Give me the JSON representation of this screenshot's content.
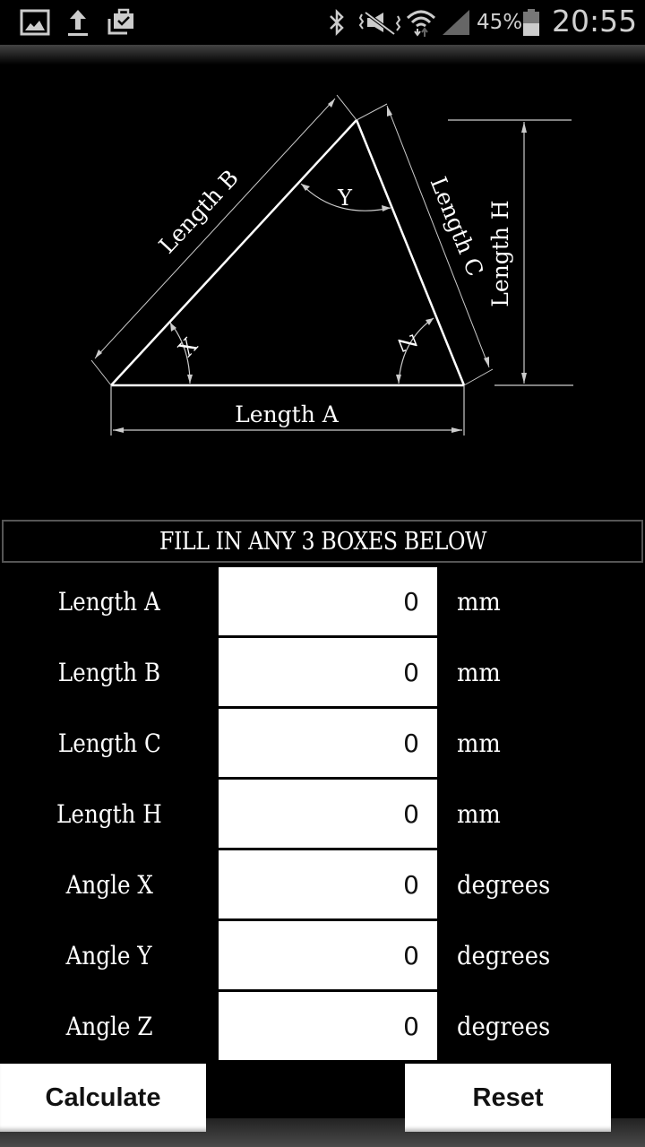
{
  "statusbar": {
    "left_icons": [
      "gallery-icon",
      "upload-icon",
      "shopping-bag-check-icon"
    ],
    "right_icons": [
      "bluetooth-icon",
      "vibrate-mute-icon",
      "wifi-icon",
      "signal-icon",
      "battery-icon"
    ],
    "battery_percent": "45%",
    "battery_level": 0.45,
    "time": "20:55"
  },
  "diagram": {
    "labels": {
      "length_a": "Length A",
      "length_b": "Length B",
      "length_c": "Length C",
      "length_h": "Length H",
      "angle_x": "X",
      "angle_y": "Y",
      "angle_z": "Z"
    }
  },
  "banner": "FILL IN ANY 3 BOXES BELOW",
  "fields": [
    {
      "label": "Length A",
      "value": "0",
      "unit": "mm"
    },
    {
      "label": "Length B",
      "value": "0",
      "unit": "mm"
    },
    {
      "label": "Length C",
      "value": "0",
      "unit": "mm"
    },
    {
      "label": "Length H",
      "value": "0",
      "unit": "mm"
    },
    {
      "label": "Angle X",
      "value": "0",
      "unit": "degrees"
    },
    {
      "label": "Angle Y",
      "value": "0",
      "unit": "degrees"
    },
    {
      "label": "Angle Z",
      "value": "0",
      "unit": "degrees"
    }
  ],
  "buttons": {
    "calculate": "Calculate",
    "reset": "Reset"
  }
}
